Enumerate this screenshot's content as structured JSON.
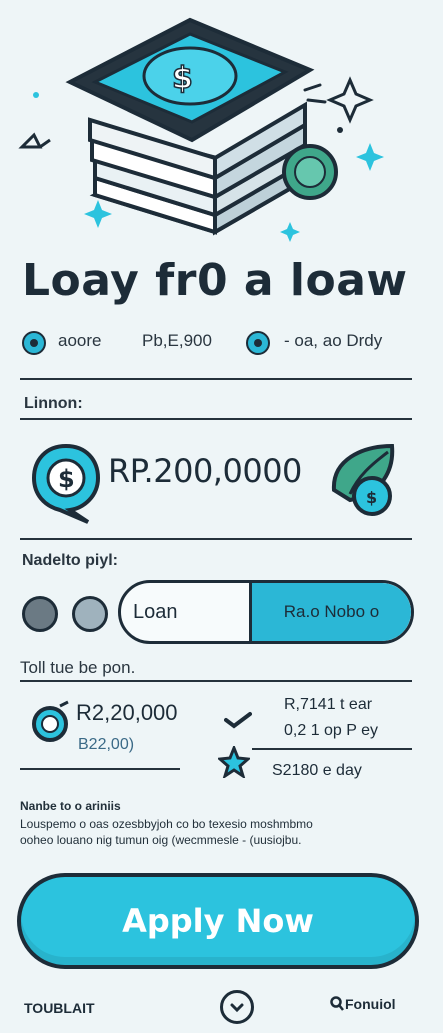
{
  "title": "Loay fr0 a loaw",
  "rates": {
    "left_label": "aoore",
    "left_value": "Pb,E,900",
    "right_value": "- oa, ao Drdy"
  },
  "amount_section": {
    "label": "Linnon:",
    "amount": "RP.200,0000",
    "currency_icon": "dollar-icon"
  },
  "purpose": {
    "label": "Nadelto piyl:",
    "toggle_left": "Loan",
    "toggle_right": "Ra.o Nobo o"
  },
  "total": {
    "label": "Toll tue be pon.",
    "main_amount": "R2,20,000",
    "sub_amount": "B22,00)",
    "stat_1": "R,7141 t ear",
    "stat_2": "0,2 1 op P ey",
    "stat_3": "S2180 e day"
  },
  "fine_print": {
    "heading": "Nanbe to o ariniis",
    "line1": "Louspemo o oas ozesbbyjoh co bo texesio moshmbmo",
    "line2": "ooheo louano nig tumun oig (wecmmesle - (uusiojbu."
  },
  "apply_button": "Apply Now",
  "footer": {
    "left": "TOUBLAIT",
    "right": "Fonuiol"
  },
  "colors": {
    "accent": "#2cc3de",
    "dark": "#1d2c38",
    "background": "#eef5f7",
    "green": "#3fa78a"
  }
}
